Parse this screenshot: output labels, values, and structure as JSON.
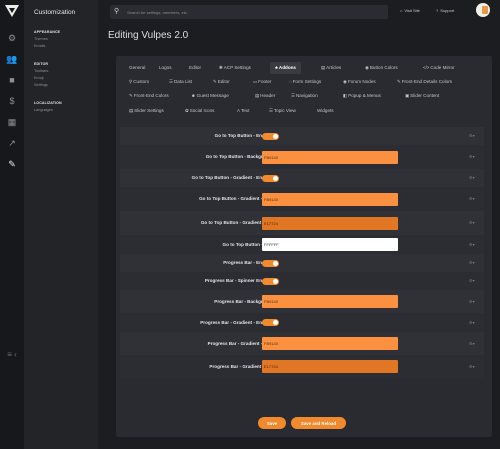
{
  "rail": {
    "icons": [
      "wrench-icon",
      "users-icon",
      "chat-icon",
      "dollar-icon",
      "clipboard-icon",
      "chart-icon",
      "brush-icon"
    ],
    "collapse": "≡ ‹"
  },
  "sidebar": {
    "title": "Customization",
    "sections": [
      {
        "heading": "APPEARANCE",
        "items": [
          "Themes",
          "Emails"
        ]
      },
      {
        "heading": "EDITOR",
        "items": [
          "Toolbars",
          "Emoji",
          "Settings"
        ]
      },
      {
        "heading": "LOCALIZATION",
        "items": [
          "Languages"
        ]
      }
    ]
  },
  "search": {
    "placeholder": "Search for settings, members, etc."
  },
  "topbar": {
    "visit_site": "Visit Site",
    "support": "Support"
  },
  "page": {
    "title": "Editing Vulpes 2.0"
  },
  "tabs": [
    {
      "label": "General",
      "icon": ""
    },
    {
      "label": "Logos",
      "icon": ""
    },
    {
      "label": "Editor",
      "icon": ""
    },
    {
      "label": "ACP Settings",
      "icon": "✱"
    },
    {
      "label": "Addons",
      "icon": "♣"
    },
    {
      "label": "Articles",
      "icon": "▤"
    },
    {
      "label": "Button Colors",
      "icon": "◉"
    },
    {
      "label": "Code Mirror",
      "icon": "</>"
    },
    {
      "label": "Custom",
      "icon": "⚲"
    },
    {
      "label": "Data List",
      "icon": "☰"
    },
    {
      "label": "Editor",
      "icon": "✎"
    },
    {
      "label": "Footer",
      "icon": "▭"
    },
    {
      "label": "Form Settings",
      "icon": "◌"
    },
    {
      "label": "Forum Nodes",
      "icon": "◉"
    },
    {
      "label": "Front-End Details Colors",
      "icon": "✎"
    },
    {
      "label": "Front-End Colors",
      "icon": "✎"
    },
    {
      "label": "Guest Message",
      "icon": "☻"
    },
    {
      "label": "Header",
      "icon": "▤"
    },
    {
      "label": "Navigation",
      "icon": "☰"
    },
    {
      "label": "Popup & Menus",
      "icon": "◧"
    },
    {
      "label": "Slider Content",
      "icon": "▣"
    },
    {
      "label": "Slider Settings",
      "icon": "▤"
    },
    {
      "label": "Social Icons",
      "icon": "✿"
    },
    {
      "label": "Text",
      "icon": "A"
    },
    {
      "label": "Topic View",
      "icon": "☰"
    },
    {
      "label": "Widgets",
      "icon": ""
    }
  ],
  "settings": [
    {
      "label": "Go to Top Button - Enable?",
      "type": "toggle",
      "checked": true
    },
    {
      "label": "Go to Top Button - Background",
      "type": "color",
      "value": "FB9140",
      "bg": "#fb9140",
      "fg": "#5a2c00"
    },
    {
      "label": "Go to Top Button - Gradient - Enable?",
      "type": "toggle",
      "checked": true
    },
    {
      "label": "Go to Top Button - Gradient - Start",
      "type": "color",
      "value": "FB9140",
      "bg": "#fb9140",
      "fg": "#5a2c00"
    },
    {
      "label": "Go to Top Button - Gradient - End",
      "type": "color",
      "value": "E17724",
      "bg": "#e17724",
      "fg": "#4a2200"
    },
    {
      "label": "Go to Top Button - Font",
      "type": "color",
      "value": "FFFFFF",
      "bg": "#ffffff",
      "fg": "#333333"
    },
    {
      "label": "Progress Bar - Enable?",
      "type": "toggle",
      "checked": true
    },
    {
      "label": "Progress Bar - Spinner Enable?",
      "type": "toggle",
      "checked": true
    },
    {
      "label": "Progress Bar - Background",
      "type": "color",
      "value": "FB9140",
      "bg": "#fb9140",
      "fg": "#5a2c00"
    },
    {
      "label": "Progress Bar - Gradient - Enable?",
      "type": "toggle",
      "checked": true
    },
    {
      "label": "Progress Bar - Gradient - Start",
      "type": "color",
      "value": "FB9140",
      "bg": "#fb9140",
      "fg": "#5a2c00"
    },
    {
      "label": "Progress Bar - Gradient - End",
      "type": "color",
      "value": "E17724",
      "bg": "#e17724",
      "fg": "#4a2200"
    }
  ],
  "actions": {
    "save": "Save",
    "save_reload": "Save and Reload"
  },
  "colors": {
    "accent": "#f08a2c",
    "panel": "#2a2b30",
    "row": "#303136"
  }
}
